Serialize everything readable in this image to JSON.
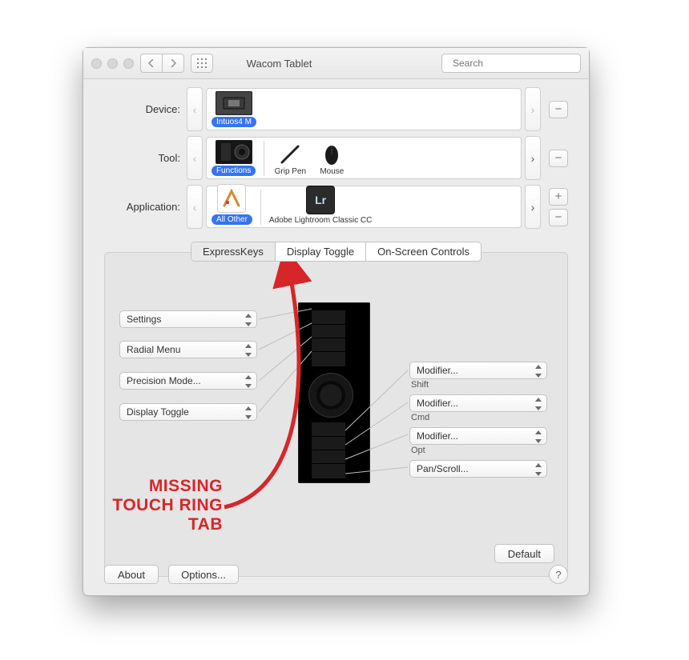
{
  "window": {
    "title": "Wacom Tablet",
    "search_placeholder": "Search"
  },
  "rows": {
    "device": {
      "label": "Device:",
      "item": "Intuos4 M"
    },
    "tool": {
      "label": "Tool:",
      "items": [
        "Functions",
        "Grip Pen",
        "Mouse"
      ]
    },
    "app": {
      "label": "Application:",
      "items": [
        "All Other",
        "Adobe Lightroom Classic CC"
      ],
      "lr_badge": "Lr"
    }
  },
  "tabs": [
    "ExpressKeys",
    "Display Toggle",
    "On-Screen Controls"
  ],
  "left_selects": [
    "Settings",
    "Radial Menu",
    "Precision Mode...",
    "Display Toggle"
  ],
  "right_selects": [
    {
      "value": "Modifier...",
      "sub": "Shift"
    },
    {
      "value": "Modifier...",
      "sub": "Cmd"
    },
    {
      "value": "Modifier...",
      "sub": "Opt"
    },
    {
      "value": "Pan/Scroll...",
      "sub": ""
    }
  ],
  "buttons": {
    "default": "Default",
    "about": "About",
    "options": "Options...",
    "help": "?"
  },
  "annotation": {
    "line1": "MISSING",
    "line2": "TOUCH RING",
    "line3": "TAB"
  }
}
